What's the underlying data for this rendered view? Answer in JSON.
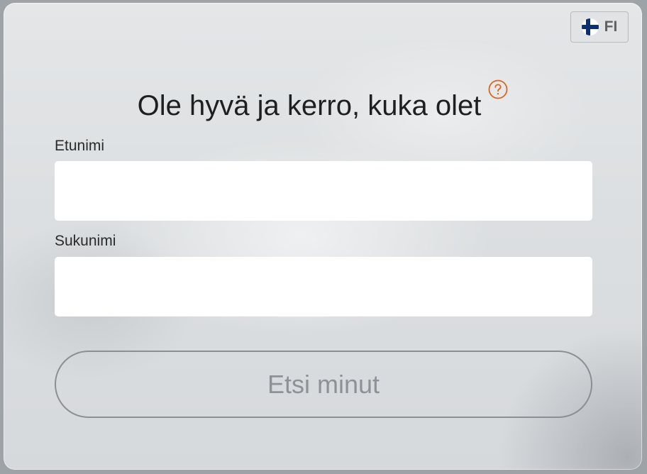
{
  "language": {
    "code": "FI",
    "flag_icon": "finland-flag-icon"
  },
  "form": {
    "title": "Ole hyvä ja kerro, kuka olet",
    "help_icon": "question-circle-icon",
    "first_name": {
      "label": "Etunimi",
      "value": "",
      "placeholder": ""
    },
    "last_name": {
      "label": "Sukunimi",
      "value": "",
      "placeholder": ""
    },
    "submit_label": "Etsi minut"
  },
  "colors": {
    "accent": "#d9661f",
    "flag_blue": "#0c2f6e",
    "button_text_disabled": "#8e9296"
  }
}
